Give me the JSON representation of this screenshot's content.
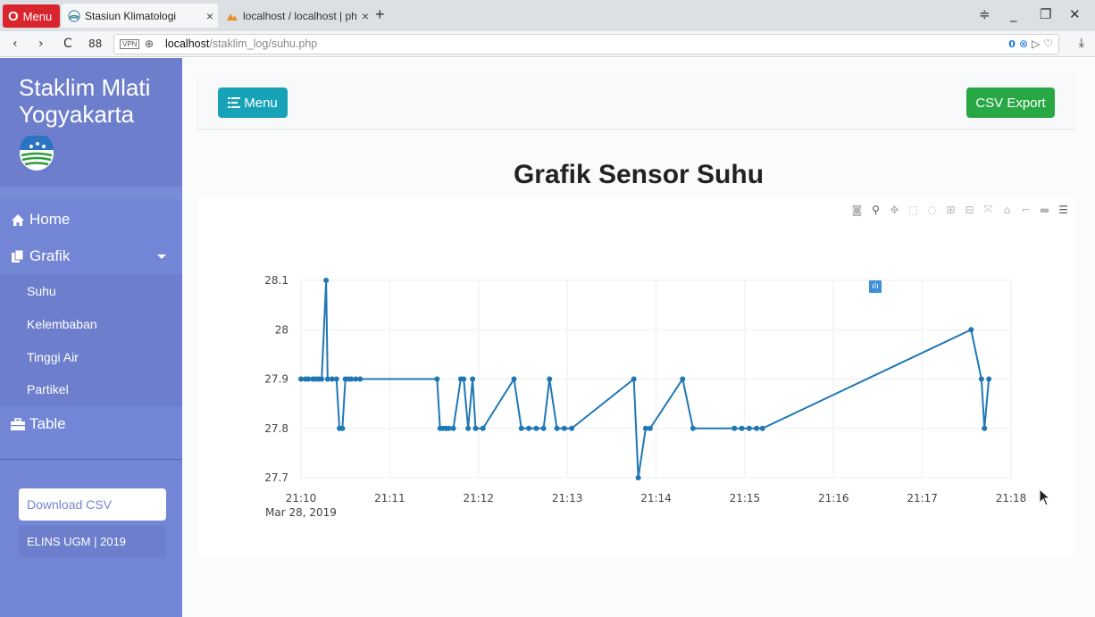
{
  "browser": {
    "menu_label": "Menu",
    "tabs": [
      {
        "title": "Stasiun Klimatologi",
        "close": "×"
      },
      {
        "title": "localhost / localhost | phpMyAdmin",
        "close": "×"
      }
    ],
    "new_tab": "+",
    "url_host": "localhost",
    "url_path": "/staklim_log/suhu.php",
    "vpn_label": "VPN",
    "adblock_count": "0"
  },
  "sidebar": {
    "brand_line1": "Staklim Mlati",
    "brand_line2": "Yogyakarta",
    "nav": {
      "home": "Home",
      "grafik": "Grafik",
      "table": "Table"
    },
    "submenu": [
      "Suhu",
      "Kelembaban",
      "Tinggi Air",
      "Partikel"
    ],
    "download_csv": "Download CSV",
    "footer": "ELINS UGM | 2019"
  },
  "toolbar": {
    "menu_button": "Menu",
    "csv_export": "CSV Export"
  },
  "page_title": "Grafik Sensor Suhu",
  "colors": {
    "sidebar": "#7386d5",
    "menu_button": "#17a2b8",
    "csv_button": "#28a745",
    "line": "#1f77b4"
  },
  "modebar_icons": [
    "camera-icon",
    "zoom-icon",
    "pan-icon",
    "box-select-icon",
    "lasso-icon",
    "zoom-in-icon",
    "zoom-out-icon",
    "autoscale-icon",
    "reset-axes-icon",
    "spike-lines-icon",
    "hover-closest-icon",
    "hover-compare-icon",
    "plotly-logo-icon"
  ],
  "chart_data": {
    "type": "line",
    "title": "",
    "xlabel": "",
    "ylabel": "",
    "x_unit": "minutes after 21:10 on Mar 28, 2019",
    "xlim": [
      21.1,
      21.18
    ],
    "x_ticks": [
      "21:10",
      "21:11",
      "21:12",
      "21:13",
      "21:14",
      "21:15",
      "21:16",
      "21:17",
      "21:18"
    ],
    "x_tick_sub": "Mar 28, 2019",
    "ylim": [
      27.7,
      28.1
    ],
    "y_ticks": [
      "27.7",
      "27.8",
      "27.9",
      "28",
      "28.1"
    ],
    "grid": true,
    "series": [
      {
        "mode": "lines+markers",
        "x": [
          "21:10:00",
          "21:10:03",
          "21:10:05",
          "21:10:08",
          "21:10:10",
          "21:10:12",
          "21:10:14",
          "21:10:17",
          "21:10:18",
          "21:10:21",
          "21:10:24",
          "21:10:26",
          "21:10:28",
          "21:10:30",
          "21:10:32",
          "21:10:34",
          "21:10:37",
          "21:10:40",
          "21:11:32",
          "21:11:34",
          "21:11:36",
          "21:11:38",
          "21:11:40",
          "21:11:43",
          "21:11:48",
          "21:11:50",
          "21:11:53",
          "21:11:56",
          "21:11:58",
          "21:12:03",
          "21:12:24",
          "21:12:29",
          "21:12:34",
          "21:12:39",
          "21:12:44",
          "21:12:48",
          "21:12:53",
          "21:12:58",
          "21:13:03",
          "21:13:45",
          "21:13:48",
          "21:13:53",
          "21:13:56",
          "21:14:18",
          "21:14:25",
          "21:14:53",
          "21:14:58",
          "21:15:03",
          "21:15:08",
          "21:15:12",
          "21:17:33",
          "21:17:40",
          "21:17:42",
          "21:17:45"
        ],
        "y": [
          27.9,
          27.9,
          27.9,
          27.9,
          27.9,
          27.9,
          27.9,
          28.1,
          27.9,
          27.9,
          27.9,
          27.8,
          27.8,
          27.9,
          27.9,
          27.9,
          27.9,
          27.9,
          27.9,
          27.8,
          27.8,
          27.8,
          27.8,
          27.8,
          27.9,
          27.9,
          27.8,
          27.9,
          27.8,
          27.8,
          27.9,
          27.8,
          27.8,
          27.8,
          27.8,
          27.9,
          27.8,
          27.8,
          27.8,
          27.9,
          27.7,
          27.8,
          27.8,
          27.9,
          27.8,
          27.8,
          27.8,
          27.8,
          27.8,
          27.8,
          28.0,
          27.9,
          27.8,
          27.9
        ]
      }
    ]
  }
}
